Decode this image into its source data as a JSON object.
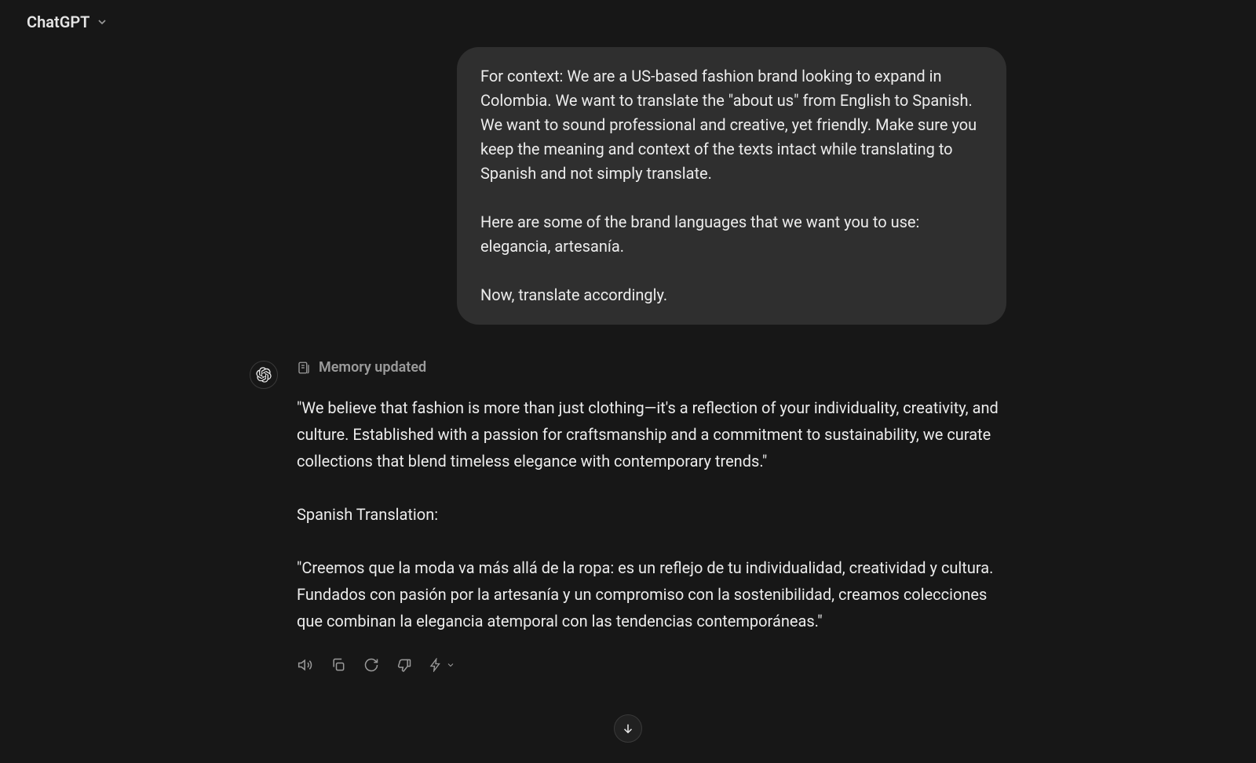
{
  "header": {
    "model_name": "ChatGPT"
  },
  "conversation": {
    "user_message": "For context: We are a US-based fashion brand looking to expand in Colombia. We want to translate the \"about us\" from English to Spanish. We want to sound professional and creative, yet friendly. Make sure you keep the meaning and context of the texts intact while translating to Spanish and not simply translate.\n\nHere are some of the brand languages that we want you to use: elegancia, artesanía.\n\nNow, translate accordingly.",
    "assistant": {
      "memory_label": "Memory updated",
      "text": "\"We believe that fashion is more than just clothing—it's a reflection of your individuality, creativity, and culture. Established with a passion for craftsmanship and a commitment to sustainability, we curate collections that blend timeless elegance with contemporary trends.\"\n\nSpanish Translation:\n\n\"Creemos que la moda va más allá de la ropa: es un reflejo de tu individualidad, creatividad y cultura. Fundados con pasión por la artesanía y un compromiso con la sostenibilidad, creamos colecciones que combinan la elegancia atemporal con las tendencias contemporáneas.\""
    }
  },
  "icons": {
    "read_aloud": "read-aloud",
    "copy": "copy",
    "regenerate": "regenerate",
    "bad": "thumbs-down",
    "model": "change-model"
  }
}
